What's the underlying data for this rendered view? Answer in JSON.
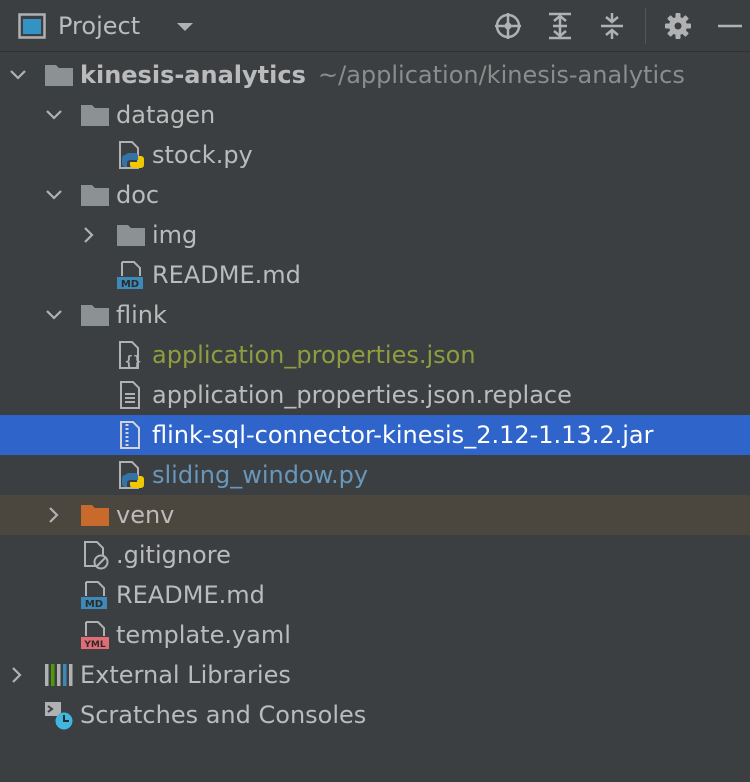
{
  "toolbar": {
    "title": "Project"
  },
  "tree": {
    "root": {
      "name": "kinesis-analytics",
      "path": "~/application/kinesis-analytics"
    },
    "datagen": "datagen",
    "stock_py": "stock.py",
    "doc": "doc",
    "img": "img",
    "doc_readme": "README.md",
    "flink": "flink",
    "app_props": "application_properties.json",
    "app_props_replace": "application_properties.json.replace",
    "jar": "flink-sql-connector-kinesis_2.12-1.13.2.jar",
    "sliding_window": "sliding_window.py",
    "venv": "venv",
    "gitignore": ".gitignore",
    "readme": "README.md",
    "template": "template.yaml",
    "external_libraries": "External Libraries",
    "scratches": "Scratches and Consoles"
  },
  "icon_badges": {
    "md": "MD",
    "yml": "YML"
  },
  "colors": {
    "background": "#3c3f41",
    "selection": "#2f65ca",
    "excluded_row": "#4b463e",
    "folder": "#8c9194",
    "excluded_folder": "#c86a2c",
    "modified_text": "#8f9d3f",
    "added_text": "#6897bb"
  }
}
